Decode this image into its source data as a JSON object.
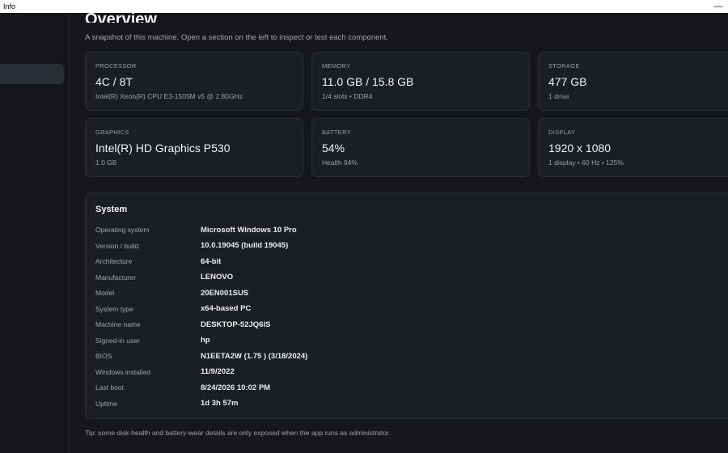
{
  "window": {
    "title": "Info"
  },
  "page": {
    "title": "Overview",
    "subtitle": "A snapshot of this machine. Open a section on the left to inspect or test each component."
  },
  "cards": [
    {
      "label": "PROCESSOR",
      "value": "4C / 8T",
      "detail": "Intel(R) Xeon(R) CPU E3-1505M v5 @ 2.80GHz"
    },
    {
      "label": "MEMORY",
      "value": "11.0 GB / 15.8 GB",
      "detail": "1/4 slots • DDR4"
    },
    {
      "label": "STORAGE",
      "value": "477 GB",
      "detail": "1 drive"
    },
    {
      "label": "GRAPHICS",
      "value": "Intel(R) HD Graphics P530",
      "detail": "1.0 GB"
    },
    {
      "label": "BATTERY",
      "value": "54%",
      "detail": "Health 94%"
    },
    {
      "label": "DISPLAY",
      "value": "1920 x 1080",
      "detail": "1 display • 60 Hz • 125%"
    }
  ],
  "system": {
    "heading": "System",
    "rows": [
      {
        "key": "Operating system",
        "value": "Microsoft Windows 10 Pro"
      },
      {
        "key": "Version / build",
        "value": "10.0.19045 (build 19045)"
      },
      {
        "key": "Architecture",
        "value": "64-bit"
      },
      {
        "key": "Manufacturer",
        "value": "LENOVO"
      },
      {
        "key": "Model",
        "value": "20EN001SUS"
      },
      {
        "key": "System type",
        "value": "x64-based PC"
      },
      {
        "key": "Machine name",
        "value": "DESKTOP-52JQ6IS"
      },
      {
        "key": "Signed-in user",
        "value": "hp"
      },
      {
        "key": "BIOS",
        "value": "N1EETA2W (1.75 ) (3/18/2024)"
      },
      {
        "key": "Windows installed",
        "value": "11/9/2022"
      },
      {
        "key": "Last boot",
        "value": "8/24/2026 10:02 PM"
      },
      {
        "key": "Uptime",
        "value": "1d 3h 57m"
      }
    ]
  },
  "tip": "Tip: some disk-health and battery-wear details are only exposed when the app runs as administrator."
}
